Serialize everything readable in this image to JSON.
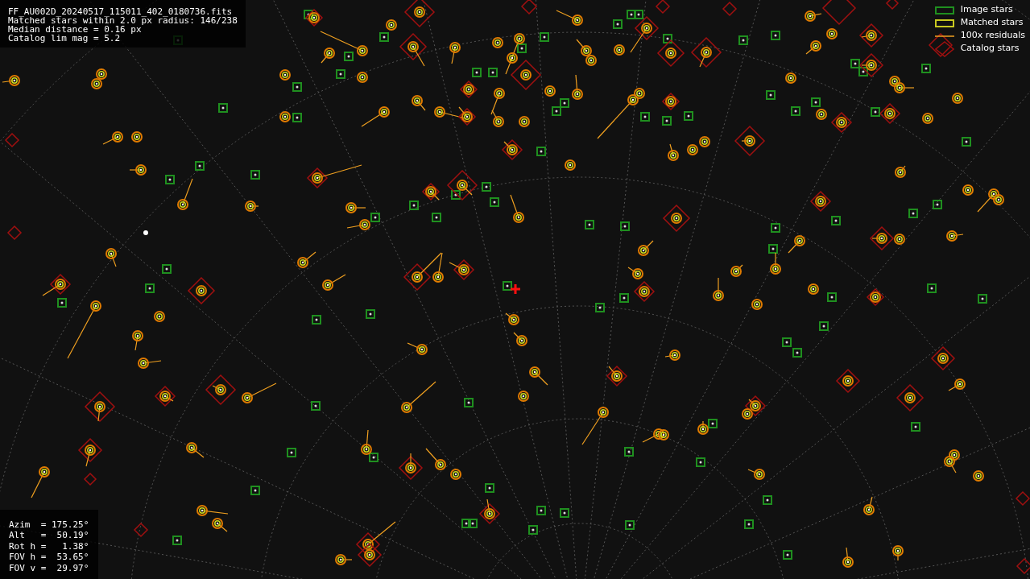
{
  "header_lines": [
    "FF_AU002D_20240517_115011_402_0180736.fits",
    "Matched stars within 2.0 px radius: 146/238",
    "Median distance = 0.16 px",
    "Catalog lim mag = 5.2"
  ],
  "legend": [
    {
      "kind": "image",
      "label": "Image stars"
    },
    {
      "kind": "matched",
      "label": "Matched stars"
    },
    {
      "kind": "residual",
      "label": "100x residuals"
    },
    {
      "kind": "catalog",
      "label": "Catalog stars"
    }
  ],
  "pointing": [
    "Azim  = 175.25°",
    "Alt   =  50.19°",
    "Rot h =   1.38°",
    "FOV h =  53.65°",
    "FOV v =  29.97°"
  ]
}
